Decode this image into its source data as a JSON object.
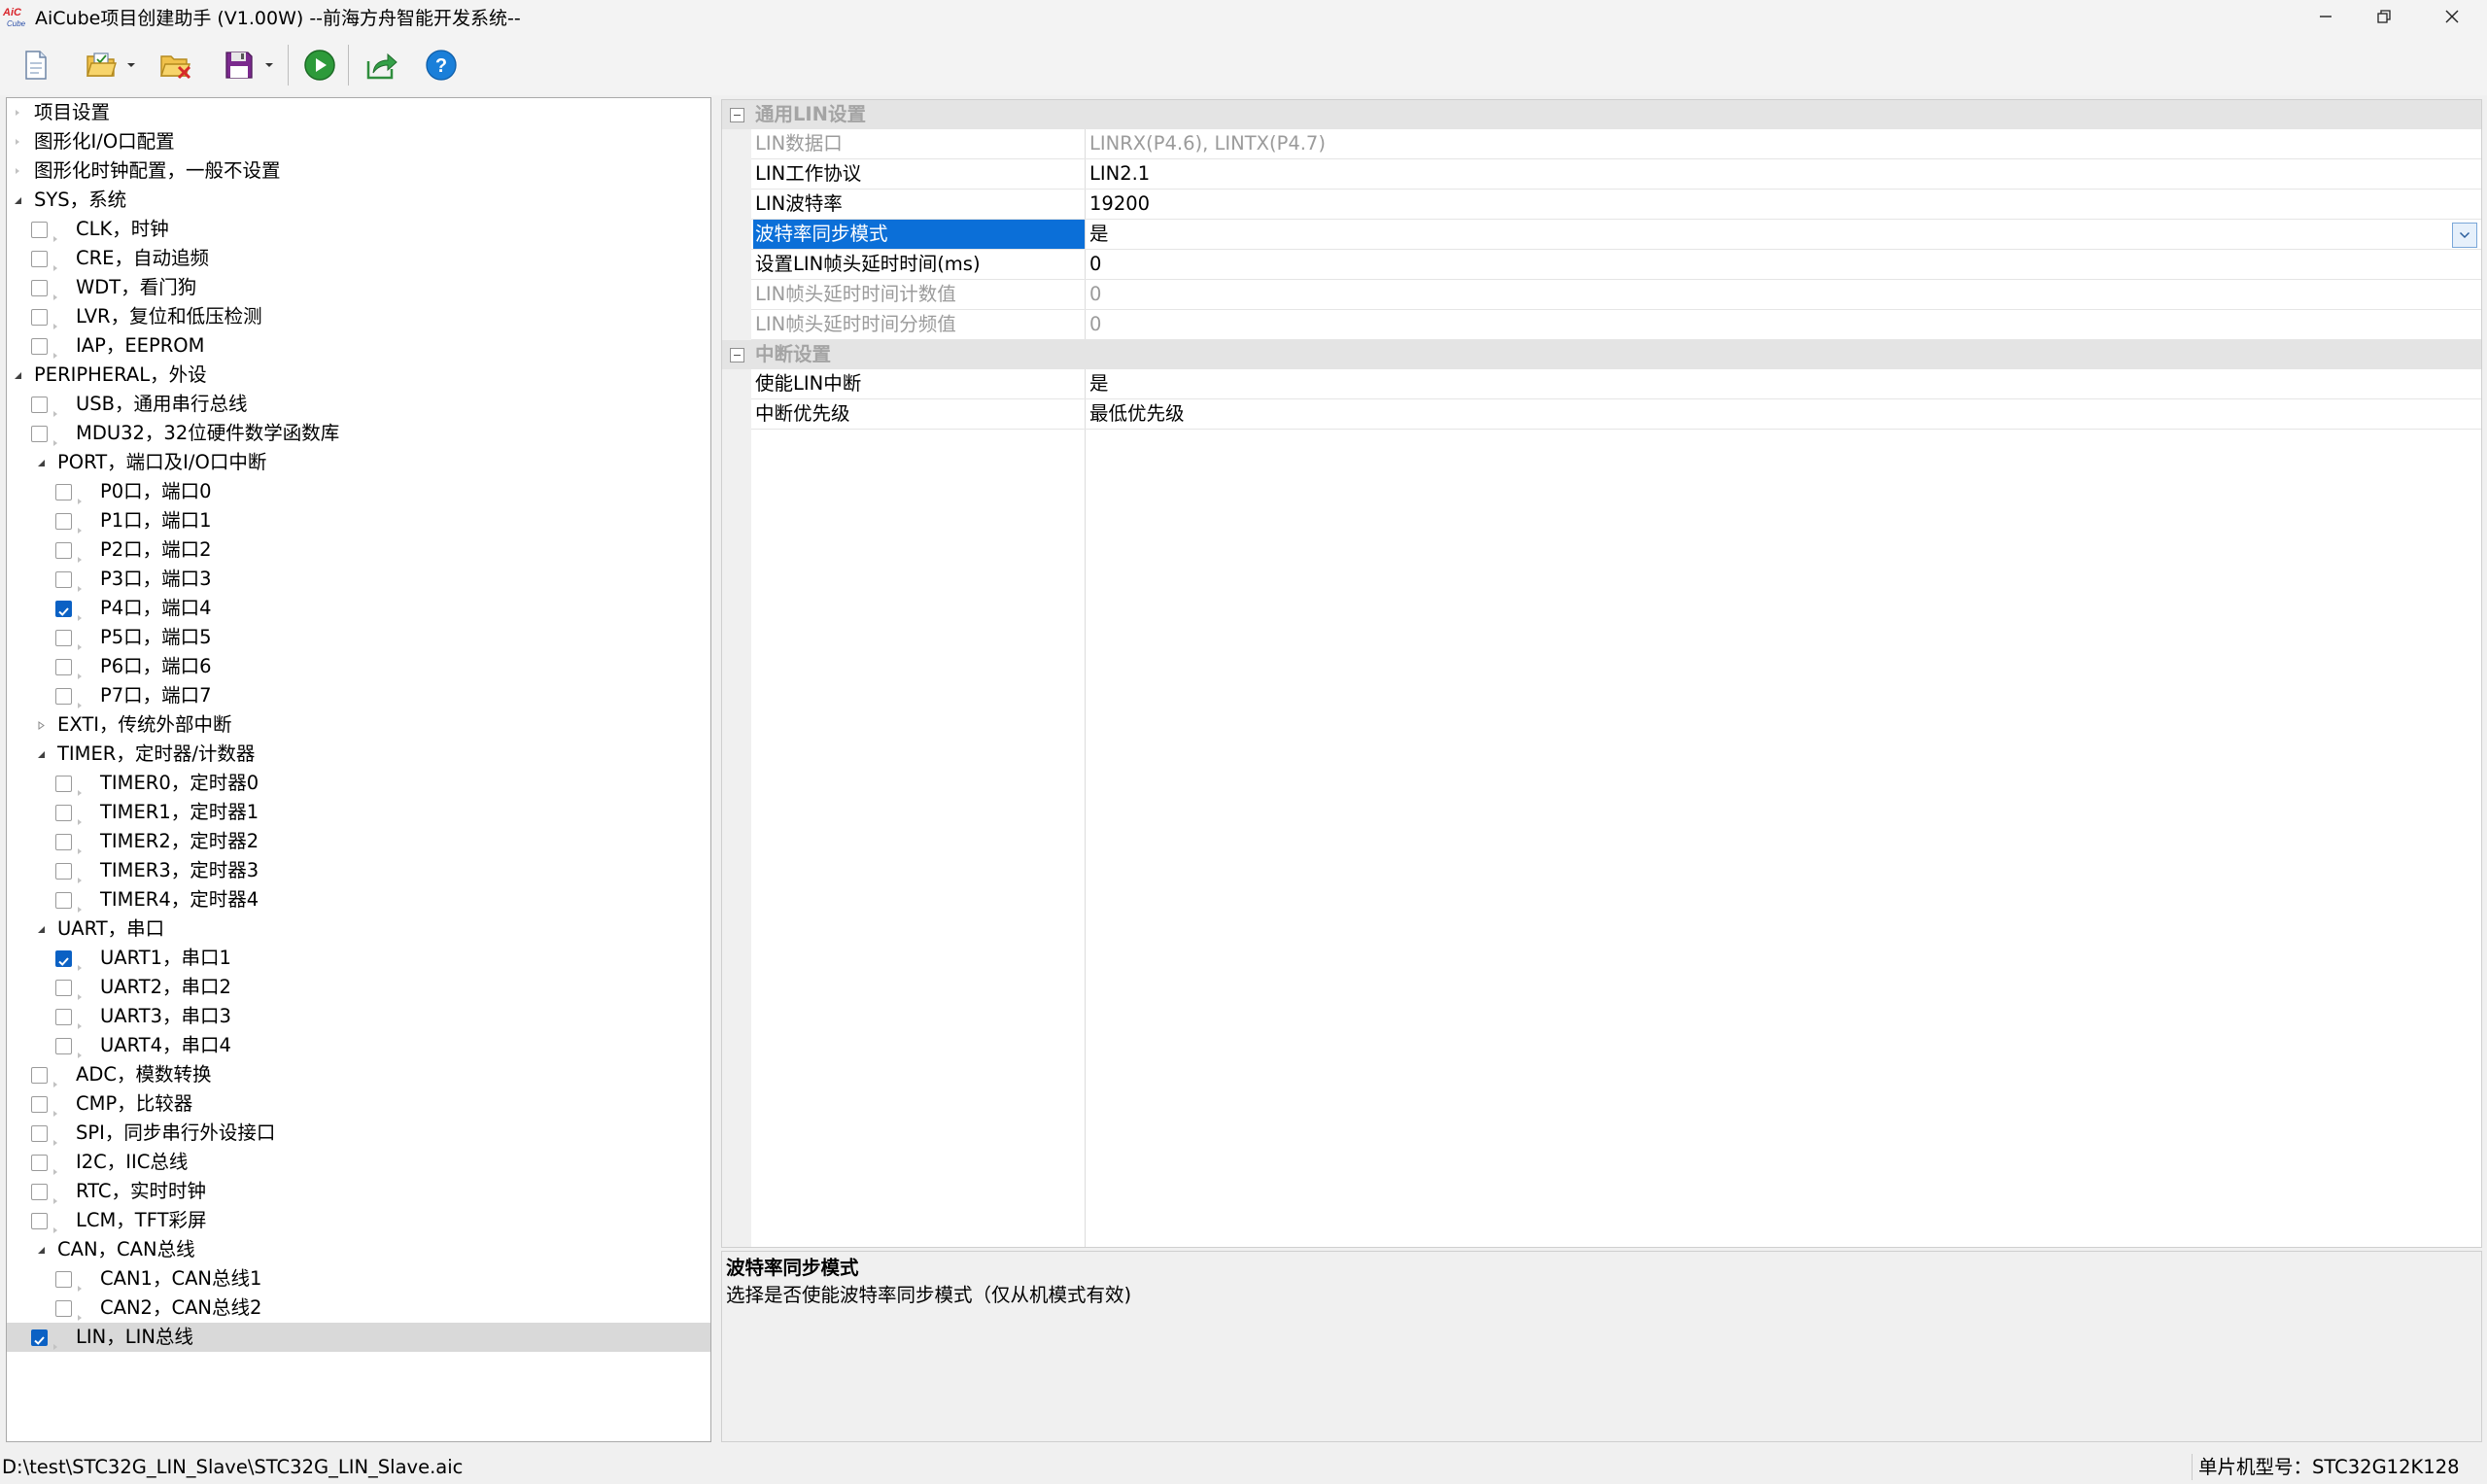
{
  "window": {
    "title": "AiCube项目创建助手 (V1.00W) --前海方舟智能开发系统--",
    "logo_text": "AiC"
  },
  "toolbar": {
    "buttons": [
      {
        "name": "new-project-button",
        "icon": "new-document-icon"
      },
      {
        "name": "open-project-button",
        "icon": "open-folder-icon"
      },
      {
        "name": "close-project-button",
        "icon": "close-folder-icon"
      },
      {
        "name": "save-project-button",
        "icon": "floppy-disk-icon"
      },
      {
        "name": "run-button",
        "icon": "play-icon"
      },
      {
        "name": "export-button",
        "icon": "export-icon"
      },
      {
        "name": "help-button",
        "icon": "help-icon"
      }
    ]
  },
  "tree": {
    "items": [
      {
        "label": "项目设置",
        "level": 0,
        "kind": "leaf"
      },
      {
        "label": "图形化I/O口配置",
        "level": 0,
        "kind": "leaf"
      },
      {
        "label": "图形化时钟配置，一般不设置",
        "level": 0,
        "kind": "leaf"
      },
      {
        "label": "SYS，系统",
        "level": 0,
        "kind": "group",
        "expanded": true
      },
      {
        "label": "CLK，时钟",
        "level": 1,
        "kind": "check",
        "checked": false
      },
      {
        "label": "CRE，自动追频",
        "level": 1,
        "kind": "check",
        "checked": false
      },
      {
        "label": "WDT，看门狗",
        "level": 1,
        "kind": "check",
        "checked": false
      },
      {
        "label": "LVR，复位和低压检测",
        "level": 1,
        "kind": "check",
        "checked": false
      },
      {
        "label": "IAP，EEPROM",
        "level": 1,
        "kind": "check",
        "checked": false
      },
      {
        "label": "PERIPHERAL，外设",
        "level": 0,
        "kind": "group",
        "expanded": true
      },
      {
        "label": "USB，通用串行总线",
        "level": 1,
        "kind": "check",
        "checked": false
      },
      {
        "label": "MDU32，32位硬件数学函数库",
        "level": 1,
        "kind": "check",
        "checked": false
      },
      {
        "label": "PORT，端口及I/O口中断",
        "level": 1,
        "kind": "group",
        "expanded": true
      },
      {
        "label": "P0口，端口0",
        "level": 2,
        "kind": "check",
        "checked": false
      },
      {
        "label": "P1口，端口1",
        "level": 2,
        "kind": "check",
        "checked": false
      },
      {
        "label": "P2口，端口2",
        "level": 2,
        "kind": "check",
        "checked": false
      },
      {
        "label": "P3口，端口3",
        "level": 2,
        "kind": "check",
        "checked": false
      },
      {
        "label": "P4口，端口4",
        "level": 2,
        "kind": "check",
        "checked": true
      },
      {
        "label": "P5口，端口5",
        "level": 2,
        "kind": "check",
        "checked": false
      },
      {
        "label": "P6口，端口6",
        "level": 2,
        "kind": "check",
        "checked": false
      },
      {
        "label": "P7口，端口7",
        "level": 2,
        "kind": "check",
        "checked": false
      },
      {
        "label": "EXTI，传统外部中断",
        "level": 1,
        "kind": "group",
        "expanded": false
      },
      {
        "label": "TIMER，定时器/计数器",
        "level": 1,
        "kind": "group",
        "expanded": true
      },
      {
        "label": "TIMER0，定时器0",
        "level": 2,
        "kind": "check",
        "checked": false
      },
      {
        "label": "TIMER1，定时器1",
        "level": 2,
        "kind": "check",
        "checked": false
      },
      {
        "label": "TIMER2，定时器2",
        "level": 2,
        "kind": "check",
        "checked": false
      },
      {
        "label": "TIMER3，定时器3",
        "level": 2,
        "kind": "check",
        "checked": false
      },
      {
        "label": "TIMER4，定时器4",
        "level": 2,
        "kind": "check",
        "checked": false
      },
      {
        "label": "UART，串口",
        "level": 1,
        "kind": "group",
        "expanded": true
      },
      {
        "label": "UART1，串口1",
        "level": 2,
        "kind": "check",
        "checked": true
      },
      {
        "label": "UART2，串口2",
        "level": 2,
        "kind": "check",
        "checked": false
      },
      {
        "label": "UART3，串口3",
        "level": 2,
        "kind": "check",
        "checked": false
      },
      {
        "label": "UART4，串口4",
        "level": 2,
        "kind": "check",
        "checked": false
      },
      {
        "label": "ADC，模数转换",
        "level": 1,
        "kind": "check",
        "checked": false
      },
      {
        "label": "CMP，比较器",
        "level": 1,
        "kind": "check",
        "checked": false
      },
      {
        "label": "SPI，同步串行外设接口",
        "level": 1,
        "kind": "check",
        "checked": false
      },
      {
        "label": "I2C，IIC总线",
        "level": 1,
        "kind": "check",
        "checked": false
      },
      {
        "label": "RTC，实时时钟",
        "level": 1,
        "kind": "check",
        "checked": false
      },
      {
        "label": "LCM，TFT彩屏",
        "level": 1,
        "kind": "check",
        "checked": false
      },
      {
        "label": "CAN，CAN总线",
        "level": 1,
        "kind": "group",
        "expanded": true
      },
      {
        "label": "CAN1，CAN总线1",
        "level": 2,
        "kind": "check",
        "checked": false
      },
      {
        "label": "CAN2，CAN总线2",
        "level": 2,
        "kind": "check",
        "checked": false
      },
      {
        "label": "LIN，LIN总线",
        "level": 1,
        "kind": "check",
        "checked": true,
        "selected": true
      }
    ]
  },
  "grid": {
    "categories": [
      {
        "name": "通用LIN设置",
        "rows": [
          {
            "name": "LIN数据口",
            "value": "LINRX(P4.6), LINTX(P4.7)",
            "readonly": true
          },
          {
            "name": "LIN工作协议",
            "value": "LIN2.1",
            "readonly": false
          },
          {
            "name": "LIN波特率",
            "value": "19200",
            "readonly": false
          },
          {
            "name": "波特率同步模式",
            "value": "是",
            "readonly": false,
            "selected": true,
            "dropdown": true
          },
          {
            "name": "设置LIN帧头延时时间(ms)",
            "value": "0",
            "readonly": false
          },
          {
            "name": "LIN帧头延时时间计数值",
            "value": "0",
            "readonly": true
          },
          {
            "name": "LIN帧头延时时间分频值",
            "value": "0",
            "readonly": true
          }
        ]
      },
      {
        "name": "中断设置",
        "rows": [
          {
            "name": "使能LIN中断",
            "value": "是",
            "readonly": false
          },
          {
            "name": "中断优先级",
            "value": "最低优先级",
            "readonly": false
          }
        ]
      }
    ]
  },
  "description": {
    "title": "波特率同步模式",
    "text": "选择是否使能波特率同步模式（仅从机模式有效)"
  },
  "statusbar": {
    "path": "D:\\test\\STC32G_LIN_Slave\\STC32G_LIN_Slave.aic",
    "model": "单片机型号：STC32G12K128"
  },
  "colors": {
    "accent": "#0b6fd8",
    "checkbox_checked": "#0b61c4",
    "selected_tree_row": "#d9d9d9",
    "readonly_text": "#9b9b9b"
  }
}
